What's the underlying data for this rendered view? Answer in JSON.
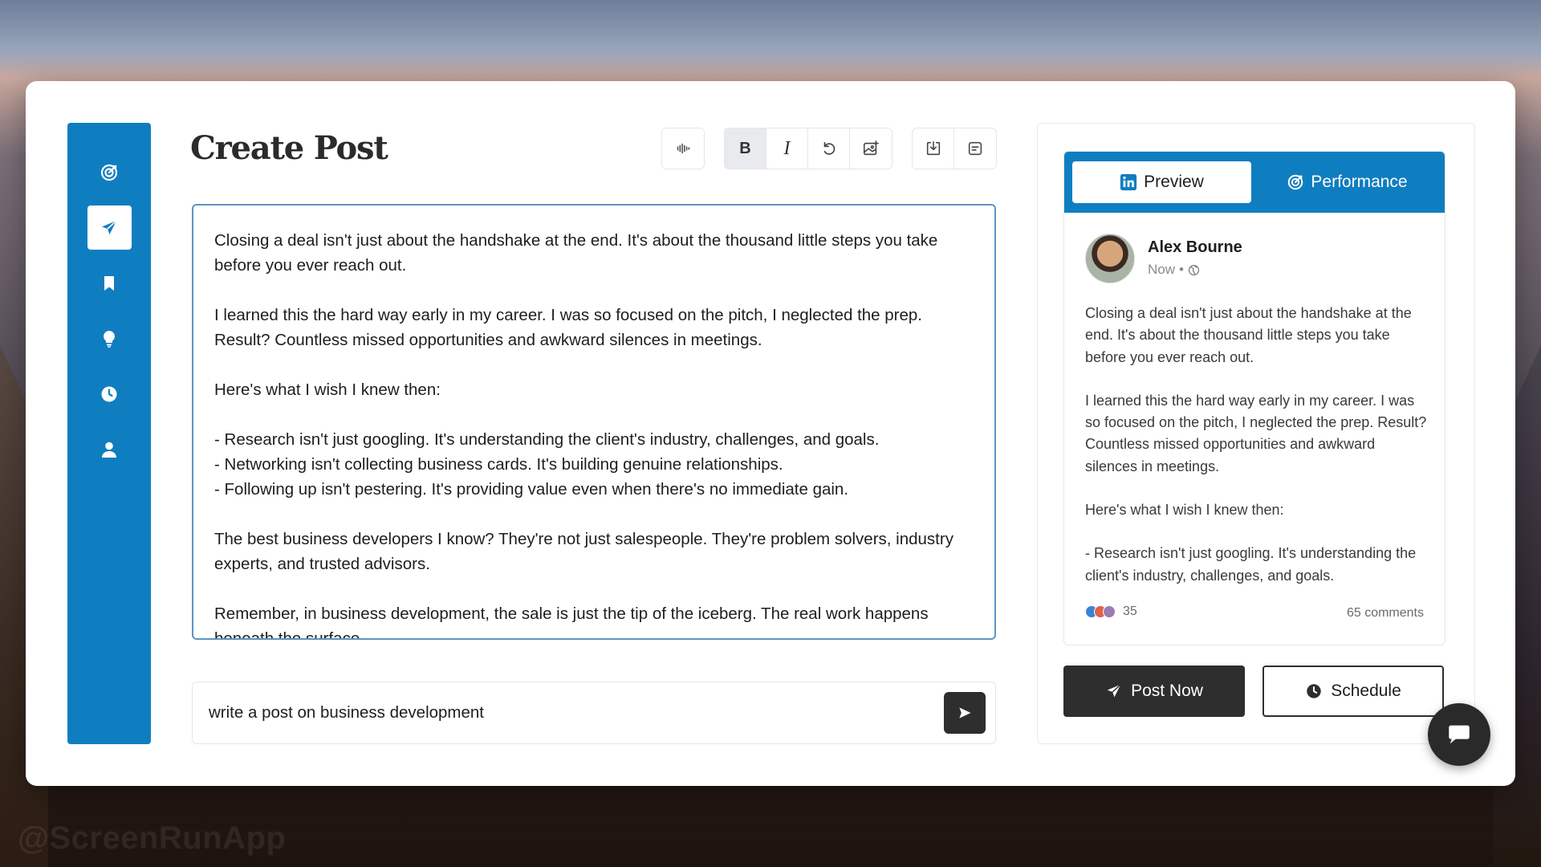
{
  "watermark": "@ScreenRunApp",
  "sidebar": {
    "items": [
      {
        "icon": "target-icon",
        "active": false
      },
      {
        "icon": "send-icon",
        "active": true
      },
      {
        "icon": "bookmark-icon",
        "active": false
      },
      {
        "icon": "lightbulb-icon",
        "active": false
      },
      {
        "icon": "clock-icon",
        "active": false
      },
      {
        "icon": "user-icon",
        "active": false
      }
    ]
  },
  "header": {
    "title": "Create Post",
    "toolbar": {
      "bold_label": "B",
      "italic_label": "I"
    }
  },
  "editor": {
    "paragraphs": [
      "Closing a deal isn't just about the handshake at the end. It's about the thousand little steps you take before you ever reach out.",
      "I learned this the hard way early in my career. I was so focused on the pitch, I neglected the prep. Result? Countless missed opportunities and awkward silences in meetings.",
      "Here's what I wish I knew then:",
      "- Research isn't just googling. It's understanding the client's industry, challenges, and goals.\n- Networking isn't collecting business cards. It's building genuine relationships.\n- Following up isn't pestering. It's providing value even when there's no immediate gain.",
      "The best business developers I know? They're not just salespeople. They're problem solvers, industry experts, and trusted advisors.",
      "Remember, in business development, the sale is just the tip of the iceberg. The real work happens beneath the surface."
    ]
  },
  "prompt": {
    "value": "write a post on business development"
  },
  "preview": {
    "tabs": {
      "preview_label": "Preview",
      "performance_label": "Performance"
    },
    "author": {
      "name": "Alex Bourne",
      "time": "Now"
    },
    "paragraphs": [
      "Closing a deal isn't just about the handshake at the end. It's about the thousand little steps you take before you ever reach out.",
      "I learned this the hard way early in my career. I was so focused on the pitch, I neglected the prep. Result? Countless missed opportunities and awkward silences in meetings.",
      "Here's what I wish I knew then:",
      "- Research isn't just googling. It's understanding the client's industry, challenges, and goals."
    ],
    "reactions_count": "35",
    "comments": "65 comments"
  },
  "actions": {
    "post_now_label": "Post Now",
    "schedule_label": "Schedule"
  },
  "colors": {
    "brand_blue": "#0f7ec0",
    "dark_button": "#2e2e2e"
  }
}
